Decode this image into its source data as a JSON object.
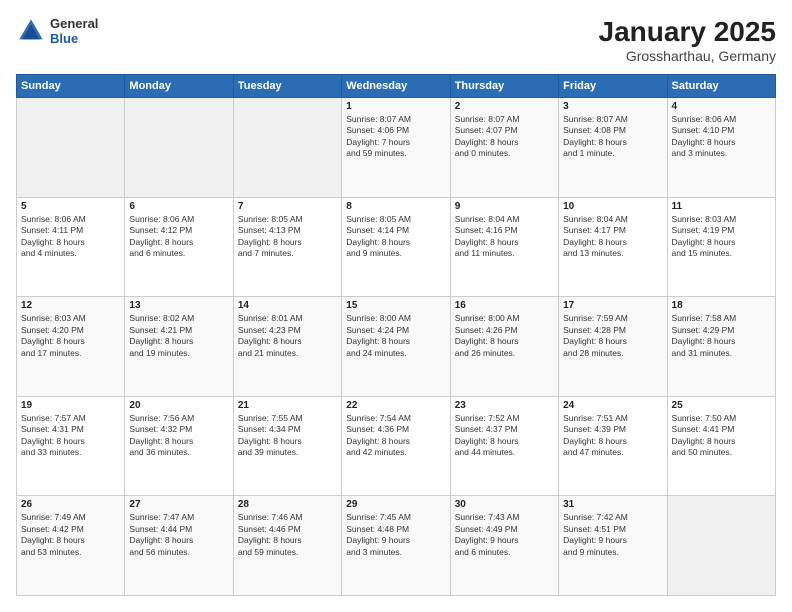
{
  "header": {
    "logo_general": "General",
    "logo_blue": "Blue",
    "title": "January 2025",
    "subtitle": "Grossharthau, Germany"
  },
  "days_of_week": [
    "Sunday",
    "Monday",
    "Tuesday",
    "Wednesday",
    "Thursday",
    "Friday",
    "Saturday"
  ],
  "weeks": [
    [
      {
        "day": "",
        "info": ""
      },
      {
        "day": "",
        "info": ""
      },
      {
        "day": "",
        "info": ""
      },
      {
        "day": "1",
        "info": "Sunrise: 8:07 AM\nSunset: 4:06 PM\nDaylight: 7 hours\nand 59 minutes."
      },
      {
        "day": "2",
        "info": "Sunrise: 8:07 AM\nSunset: 4:07 PM\nDaylight: 8 hours\nand 0 minutes."
      },
      {
        "day": "3",
        "info": "Sunrise: 8:07 AM\nSunset: 4:08 PM\nDaylight: 8 hours\nand 1 minute."
      },
      {
        "day": "4",
        "info": "Sunrise: 8:06 AM\nSunset: 4:10 PM\nDaylight: 8 hours\nand 3 minutes."
      }
    ],
    [
      {
        "day": "5",
        "info": "Sunrise: 8:06 AM\nSunset: 4:11 PM\nDaylight: 8 hours\nand 4 minutes."
      },
      {
        "day": "6",
        "info": "Sunrise: 8:06 AM\nSunset: 4:12 PM\nDaylight: 8 hours\nand 6 minutes."
      },
      {
        "day": "7",
        "info": "Sunrise: 8:05 AM\nSunset: 4:13 PM\nDaylight: 8 hours\nand 7 minutes."
      },
      {
        "day": "8",
        "info": "Sunrise: 8:05 AM\nSunset: 4:14 PM\nDaylight: 8 hours\nand 9 minutes."
      },
      {
        "day": "9",
        "info": "Sunrise: 8:04 AM\nSunset: 4:16 PM\nDaylight: 8 hours\nand 11 minutes."
      },
      {
        "day": "10",
        "info": "Sunrise: 8:04 AM\nSunset: 4:17 PM\nDaylight: 8 hours\nand 13 minutes."
      },
      {
        "day": "11",
        "info": "Sunrise: 8:03 AM\nSunset: 4:19 PM\nDaylight: 8 hours\nand 15 minutes."
      }
    ],
    [
      {
        "day": "12",
        "info": "Sunrise: 8:03 AM\nSunset: 4:20 PM\nDaylight: 8 hours\nand 17 minutes."
      },
      {
        "day": "13",
        "info": "Sunrise: 8:02 AM\nSunset: 4:21 PM\nDaylight: 8 hours\nand 19 minutes."
      },
      {
        "day": "14",
        "info": "Sunrise: 8:01 AM\nSunset: 4:23 PM\nDaylight: 8 hours\nand 21 minutes."
      },
      {
        "day": "15",
        "info": "Sunrise: 8:00 AM\nSunset: 4:24 PM\nDaylight: 8 hours\nand 24 minutes."
      },
      {
        "day": "16",
        "info": "Sunrise: 8:00 AM\nSunset: 4:26 PM\nDaylight: 8 hours\nand 26 minutes."
      },
      {
        "day": "17",
        "info": "Sunrise: 7:59 AM\nSunset: 4:28 PM\nDaylight: 8 hours\nand 28 minutes."
      },
      {
        "day": "18",
        "info": "Sunrise: 7:58 AM\nSunset: 4:29 PM\nDaylight: 8 hours\nand 31 minutes."
      }
    ],
    [
      {
        "day": "19",
        "info": "Sunrise: 7:57 AM\nSunset: 4:31 PM\nDaylight: 8 hours\nand 33 minutes."
      },
      {
        "day": "20",
        "info": "Sunrise: 7:56 AM\nSunset: 4:32 PM\nDaylight: 8 hours\nand 36 minutes."
      },
      {
        "day": "21",
        "info": "Sunrise: 7:55 AM\nSunset: 4:34 PM\nDaylight: 8 hours\nand 39 minutes."
      },
      {
        "day": "22",
        "info": "Sunrise: 7:54 AM\nSunset: 4:36 PM\nDaylight: 8 hours\nand 42 minutes."
      },
      {
        "day": "23",
        "info": "Sunrise: 7:52 AM\nSunset: 4:37 PM\nDaylight: 8 hours\nand 44 minutes."
      },
      {
        "day": "24",
        "info": "Sunrise: 7:51 AM\nSunset: 4:39 PM\nDaylight: 8 hours\nand 47 minutes."
      },
      {
        "day": "25",
        "info": "Sunrise: 7:50 AM\nSunset: 4:41 PM\nDaylight: 8 hours\nand 50 minutes."
      }
    ],
    [
      {
        "day": "26",
        "info": "Sunrise: 7:49 AM\nSunset: 4:42 PM\nDaylight: 8 hours\nand 53 minutes."
      },
      {
        "day": "27",
        "info": "Sunrise: 7:47 AM\nSunset: 4:44 PM\nDaylight: 8 hours\nand 56 minutes."
      },
      {
        "day": "28",
        "info": "Sunrise: 7:46 AM\nSunset: 4:46 PM\nDaylight: 8 hours\nand 59 minutes."
      },
      {
        "day": "29",
        "info": "Sunrise: 7:45 AM\nSunset: 4:48 PM\nDaylight: 9 hours\nand 3 minutes."
      },
      {
        "day": "30",
        "info": "Sunrise: 7:43 AM\nSunset: 4:49 PM\nDaylight: 9 hours\nand 6 minutes."
      },
      {
        "day": "31",
        "info": "Sunrise: 7:42 AM\nSunset: 4:51 PM\nDaylight: 9 hours\nand 9 minutes."
      },
      {
        "day": "",
        "info": ""
      }
    ]
  ]
}
